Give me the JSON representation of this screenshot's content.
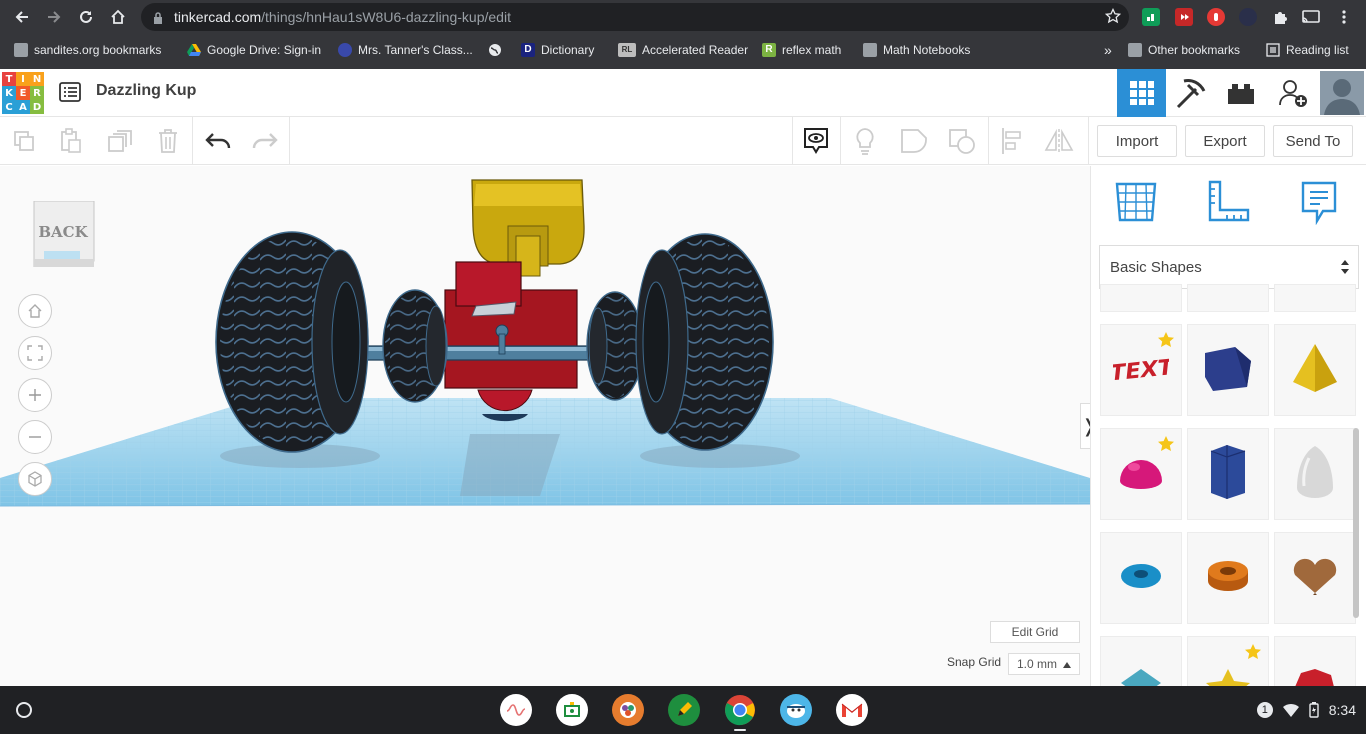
{
  "browser": {
    "url_domain": "tinkercad.com",
    "url_path": "/things/hnHau1sW8U6-dazzling-kup/edit",
    "bookmarks": [
      {
        "label": "sandites.org bookmarks",
        "icon": "folder-icon"
      },
      {
        "label": "Google Drive: Sign-in",
        "icon": "google-drive-icon"
      },
      {
        "label": "Mrs. Tanner's Class...",
        "icon": "class-site-icon"
      },
      {
        "label": "",
        "icon": "globe-icon"
      },
      {
        "label": "Dictionary",
        "icon": "dictionary-icon"
      },
      {
        "label": "Accelerated Reader",
        "icon": "accelerated-reader-icon"
      },
      {
        "label": "reflex math",
        "icon": "reflex-icon"
      },
      {
        "label": "Math Notebooks",
        "icon": "folder-icon"
      }
    ],
    "more_bookmarks": "»",
    "other_bookmarks": "Other bookmarks",
    "reading_list": "Reading list"
  },
  "app": {
    "logo_letters": [
      "T",
      "I",
      "N",
      "K",
      "E",
      "R",
      "C",
      "A",
      "D"
    ],
    "design_name": "Dazzling Kup"
  },
  "toolbar": {
    "import": "Import",
    "export": "Export",
    "send_to": "Send To"
  },
  "workplane": {
    "viewcube_label": "BACK",
    "edit_grid": "Edit Grid",
    "snap_grid_label": "Snap Grid",
    "snap_grid_value": "1.0 mm",
    "collapse_glyph": "❭"
  },
  "panel": {
    "category": "Basic Shapes",
    "shapes": [
      {
        "name": "Text",
        "color": "#c8202b",
        "favorite": true
      },
      {
        "name": "Box",
        "color": "#2c3e8c",
        "favorite": false
      },
      {
        "name": "Pyramid",
        "color": "#e5c020",
        "favorite": false
      },
      {
        "name": "Half Sphere",
        "color": "#d6187a",
        "favorite": true
      },
      {
        "name": "Polygon",
        "color": "#2c4a9a",
        "favorite": false
      },
      {
        "name": "Paraboloid",
        "color": "#d8d8d8",
        "favorite": false
      },
      {
        "name": "Torus",
        "color": "#1a8fc8",
        "favorite": false
      },
      {
        "name": "Tube",
        "color": "#e07a1c",
        "favorite": false
      },
      {
        "name": "Heart",
        "color": "#a0693c",
        "favorite": false
      },
      {
        "name": "Star-diamond",
        "color": "#4aa8c0",
        "favorite": false
      },
      {
        "name": "Star",
        "color": "#e5c020",
        "favorite": true
      },
      {
        "name": "Icosahedron",
        "color": "#c8202b",
        "favorite": false
      }
    ]
  },
  "shelf": {
    "notification_count": "1",
    "time": "8:34"
  }
}
